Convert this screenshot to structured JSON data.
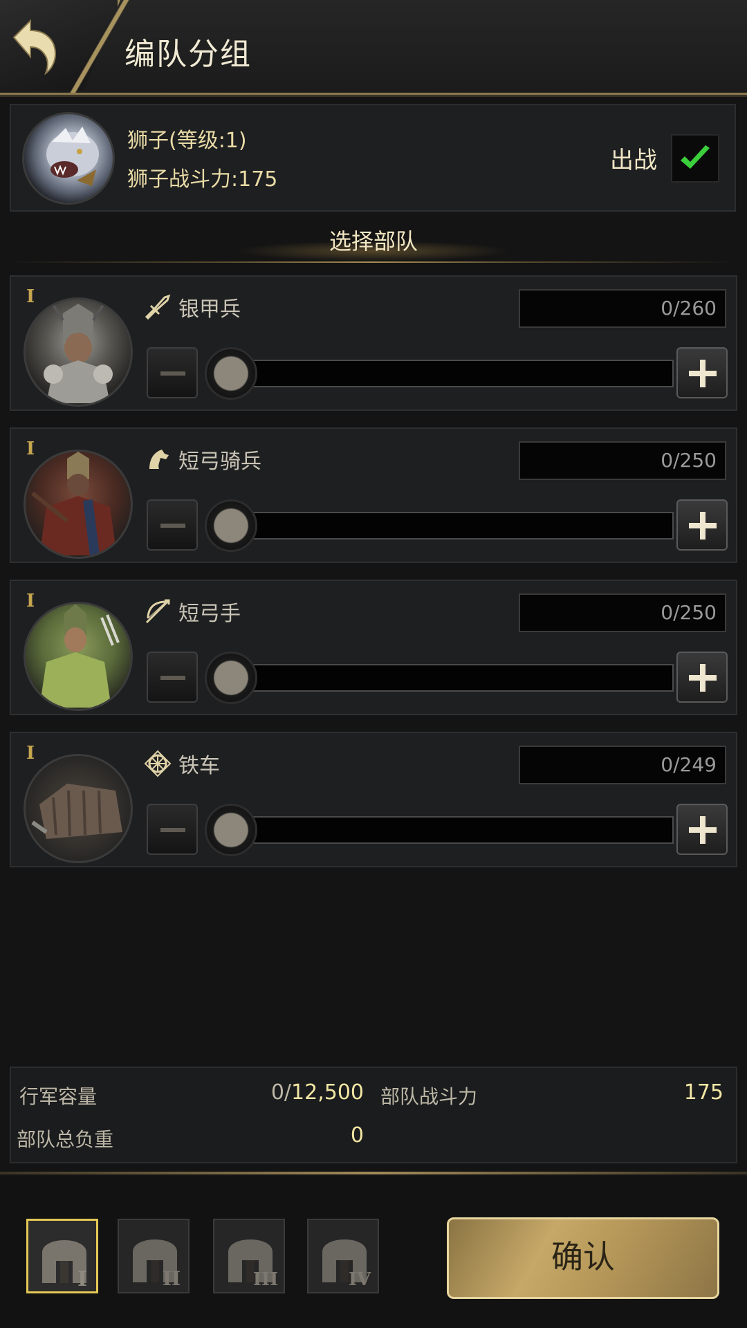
{
  "header": {
    "title": "编队分组",
    "back_icon": "back-arrow-icon"
  },
  "hero": {
    "name": "狮子(等级:1)",
    "power": "狮子战斗力:175",
    "deploy_label": "出战",
    "deploy_checked": true
  },
  "section_title": "选择部队",
  "units": [
    {
      "tier": "I",
      "name": "银甲兵",
      "type_icon": "infantry-icon",
      "count": "0/260",
      "value": 0
    },
    {
      "tier": "I",
      "name": "短弓骑兵",
      "type_icon": "cavalry-icon",
      "count": "0/250",
      "value": 0
    },
    {
      "tier": "I",
      "name": "短弓手",
      "type_icon": "archer-icon",
      "count": "0/250",
      "value": 0
    },
    {
      "tier": "I",
      "name": "铁车",
      "type_icon": "siege-icon",
      "count": "0/249",
      "value": 0
    }
  ],
  "stats": {
    "march_capacity_label": "行军容量",
    "march_capacity_used": "0/",
    "march_capacity_max": "12,500",
    "troop_power_label": "部队战斗力",
    "troop_power_value": "175",
    "total_load_label": "部队总负重",
    "total_load_value": "0"
  },
  "formations": [
    {
      "numeral": "I",
      "active": true
    },
    {
      "numeral": "II",
      "active": false
    },
    {
      "numeral": "III",
      "active": false
    },
    {
      "numeral": "IV",
      "active": false
    }
  ],
  "confirm_label": "确认",
  "colors": {
    "accent_gold": "#e5c955",
    "check_green": "#3ccf3c",
    "value_yellow": "#f3e7a4"
  }
}
